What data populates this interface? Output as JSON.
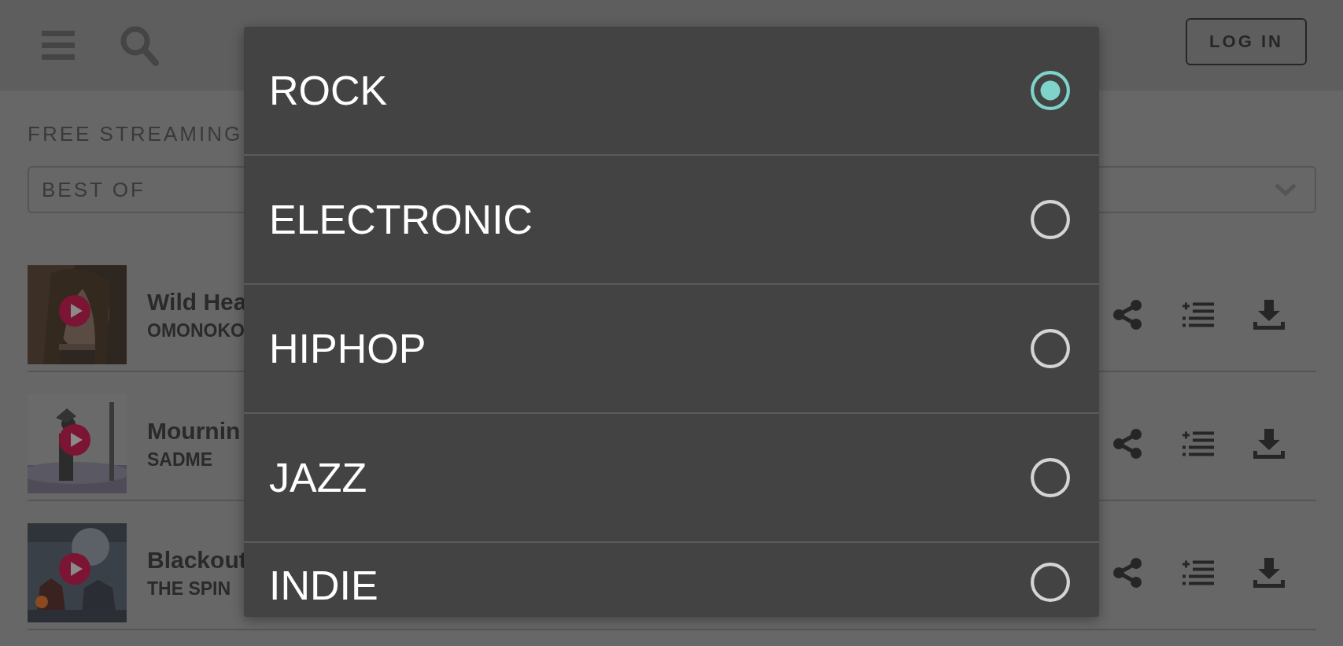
{
  "header": {
    "login_button": "LOG IN"
  },
  "breadcrumb": "FREE STREAMING",
  "filter": {
    "value": "BEST OF"
  },
  "tracks": [
    {
      "title": "Wild Hea",
      "artist": "OMONOKO"
    },
    {
      "title": "Mournin",
      "artist": "SADME"
    },
    {
      "title": "Blackout",
      "artist": "THE SPIN"
    }
  ],
  "dialog": {
    "options": [
      {
        "label": "ROCK",
        "selected": true
      },
      {
        "label": "ELECTRONIC",
        "selected": false
      },
      {
        "label": "HIPHOP",
        "selected": false
      },
      {
        "label": "JAZZ",
        "selected": false
      },
      {
        "label": "INDIE",
        "selected": false
      }
    ]
  }
}
